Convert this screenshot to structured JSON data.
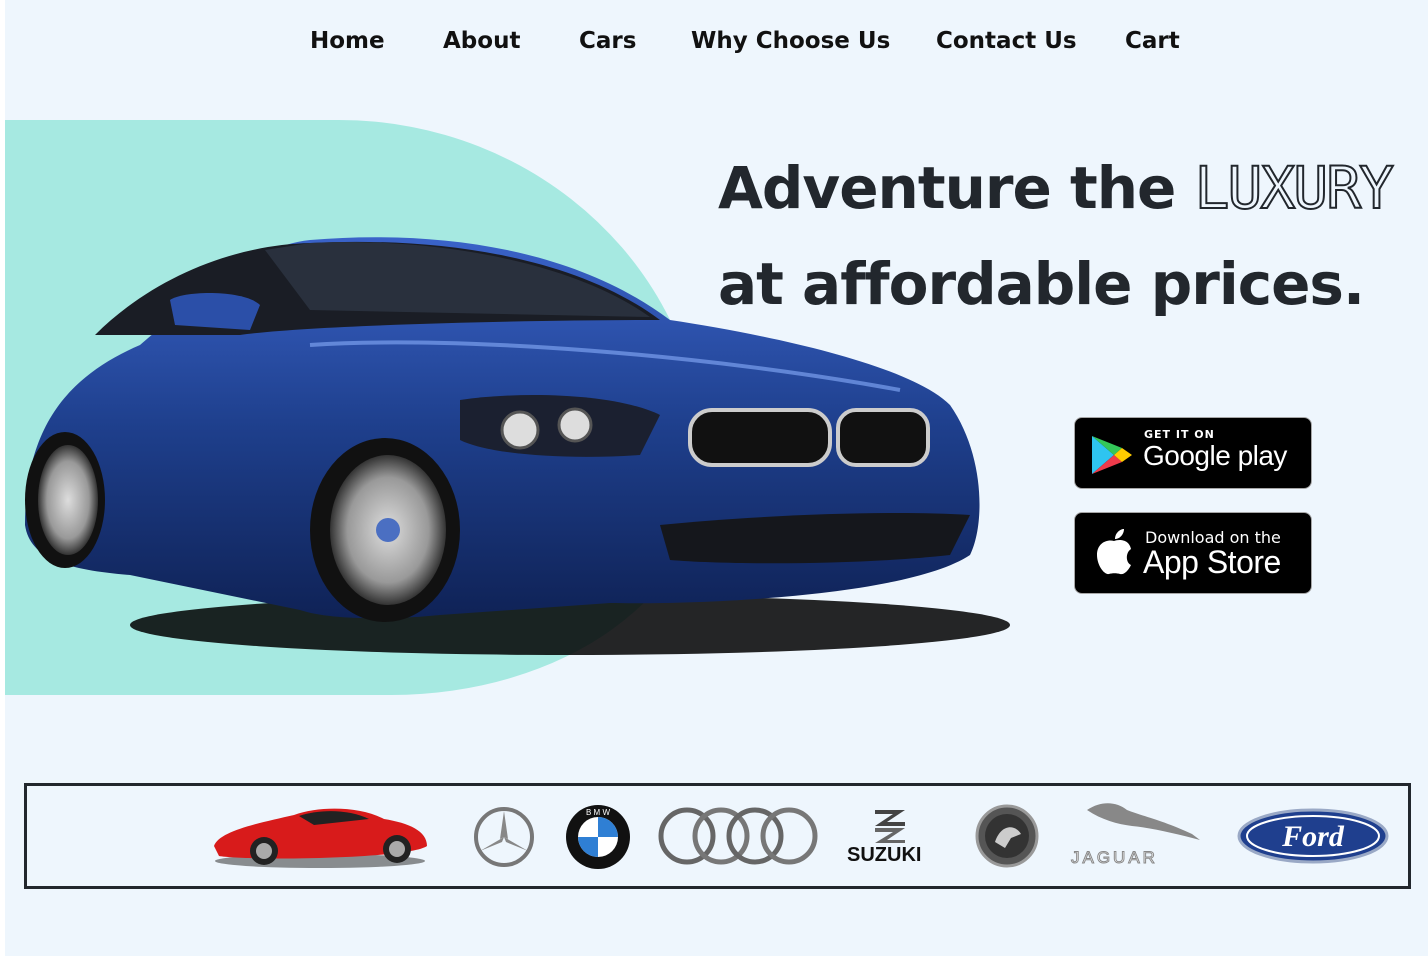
{
  "nav": {
    "items": [
      "Home",
      "About",
      "Cars",
      "Why Choose Us",
      "Contact Us",
      "Cart"
    ]
  },
  "hero": {
    "headline_part1": "Adventure the",
    "headline_highlight": "LUXURY",
    "headline_part2": "at affordable prices.",
    "car_image": "blue-bmw-coupe"
  },
  "badges": {
    "google": {
      "small": "GET IT ON",
      "big": "Google play"
    },
    "apple": {
      "small": "Download on the",
      "big": "App Store"
    }
  },
  "brands": {
    "items": [
      "red-sports-car",
      "mercedes-logo",
      "bmw-logo",
      "audi-logo",
      "suzuki-logo",
      "skoda-logo",
      "jaguar-logo",
      "ford-logo"
    ],
    "suzuki_label": "SUZUKI",
    "jaguar_label": "JAGUAR",
    "ford_label": "Ford",
    "bmw_letters": "B M W"
  },
  "colors": {
    "background": "#eef6fd",
    "blob": "#a6e9e1",
    "text": "#22272d",
    "car": "#1e3f8c"
  }
}
